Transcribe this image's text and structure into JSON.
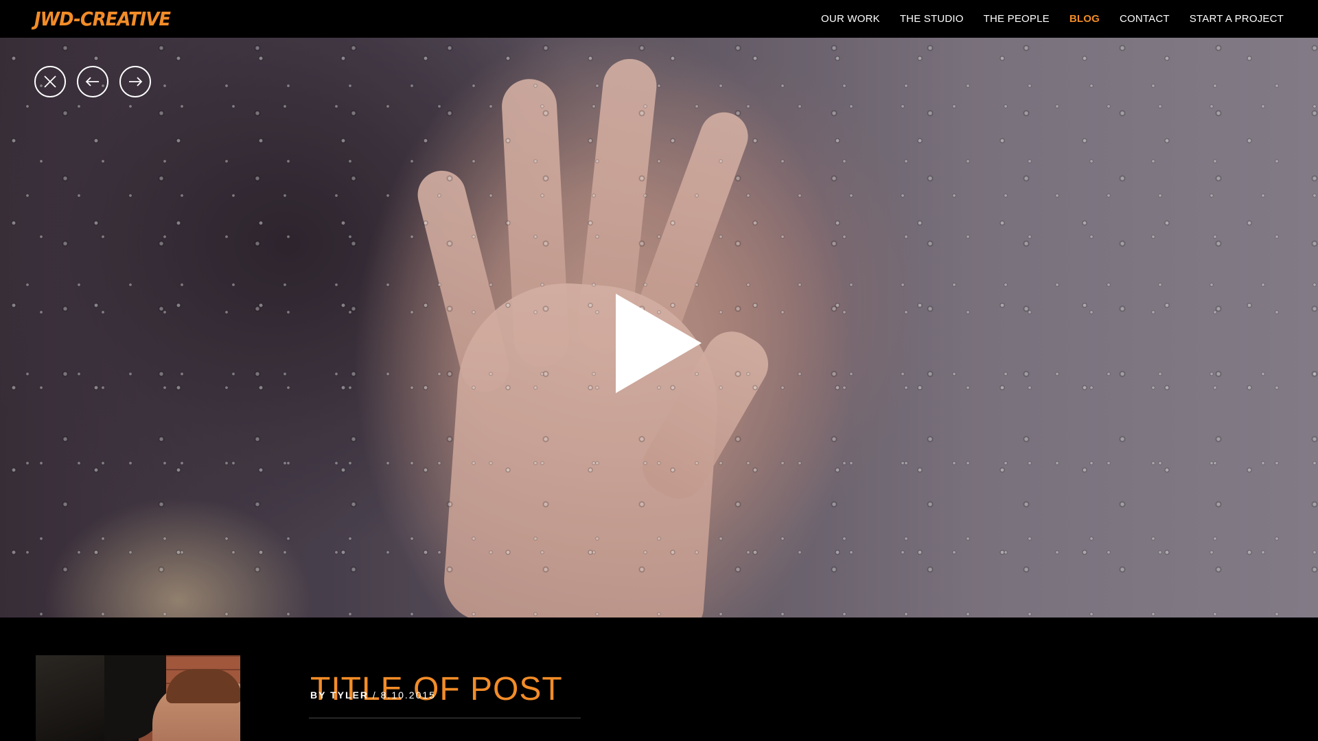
{
  "brand": {
    "logo_text": "JWD-CREATIVE",
    "accent_color": "#f28c28"
  },
  "nav": {
    "items": [
      {
        "label": "OUR WORK",
        "active": false
      },
      {
        "label": "THE STUDIO",
        "active": false
      },
      {
        "label": "THE PEOPLE",
        "active": false
      },
      {
        "label": "BLOG",
        "active": true
      },
      {
        "label": "CONTACT",
        "active": false
      },
      {
        "label": "START A PROJECT",
        "active": false
      }
    ]
  },
  "media_controls": {
    "close_icon": "close-icon",
    "prev_icon": "arrow-left-icon",
    "next_icon": "arrow-right-icon",
    "play_icon": "play-icon"
  },
  "post": {
    "title": "TITLE OF POST",
    "by_label": "BY TYLER",
    "separator": " / ",
    "date": "8.10.2015"
  }
}
